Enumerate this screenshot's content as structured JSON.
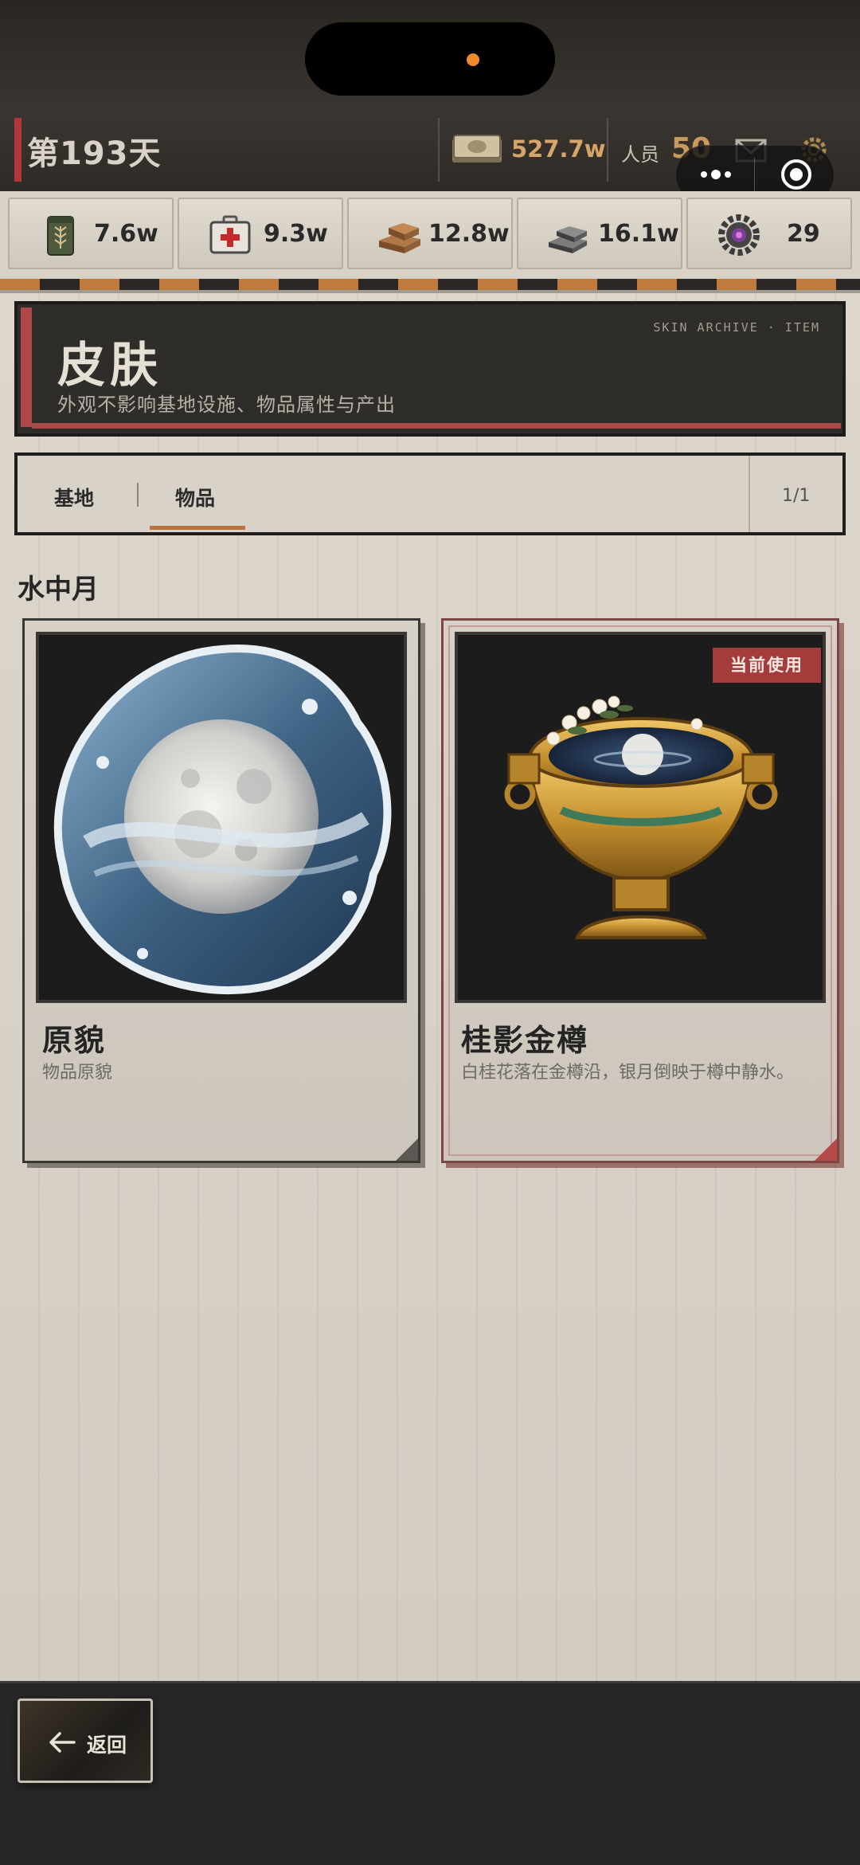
{
  "status": {
    "day_label": "第193天",
    "money": "527.7w",
    "people_label": "人员",
    "people_value": "50"
  },
  "resources": [
    {
      "icon": "grain-sack-icon",
      "value": "7.6w"
    },
    {
      "icon": "medkit-icon",
      "value": "9.3w"
    },
    {
      "icon": "wood-planks-icon",
      "value": "12.8w"
    },
    {
      "icon": "steel-ingots-icon",
      "value": "16.1w"
    },
    {
      "icon": "gear-core-icon",
      "value": "29"
    }
  ],
  "header": {
    "title": "皮肤",
    "subtitle": "外观不影响基地设施、物品属性与产出",
    "tag": "SKIN ARCHIVE · ITEM"
  },
  "tabs": {
    "items": [
      "基地",
      "物品"
    ],
    "active": "物品",
    "page": "1/1"
  },
  "section": {
    "title": "水中月"
  },
  "cards": [
    {
      "name": "原貌",
      "desc": "物品原貌",
      "selected": false,
      "image": "moon-in-water-orb"
    },
    {
      "name": "桂影金樽",
      "desc": "白桂花落在金樽沿，银月倒映于樽中静水。",
      "selected": true,
      "badge": "当前使用",
      "image": "golden-goblet-moon"
    }
  ],
  "footer": {
    "back_label": "返回"
  },
  "colors": {
    "accent_red": "#b3363a",
    "money_gold": "#d7a56a",
    "stripe_orange": "#c07a3c",
    "badge_red": "#a53b3b"
  }
}
